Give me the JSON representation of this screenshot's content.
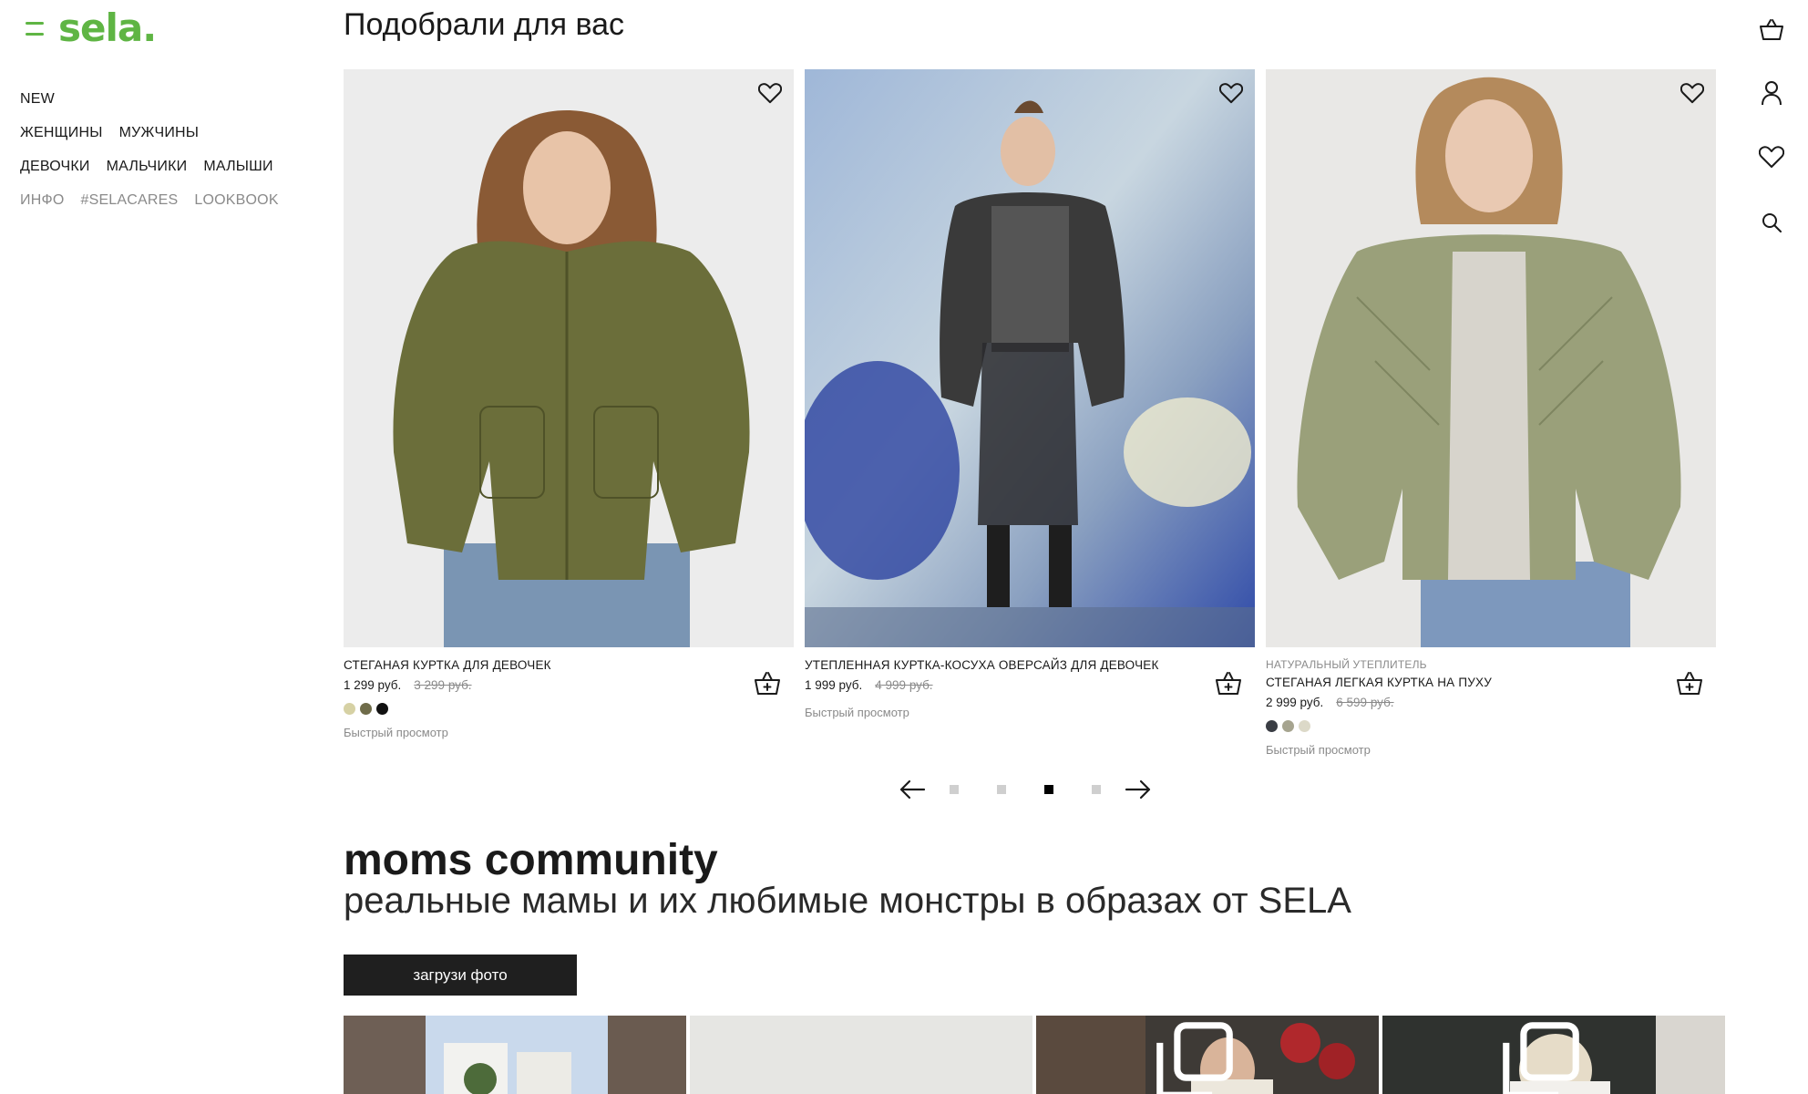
{
  "brand": {
    "name": "sela.",
    "color": "#5fb544"
  },
  "nav": {
    "rows": [
      [
        {
          "label": "NEW"
        }
      ],
      [
        {
          "label": "ЖЕНЩИНЫ"
        },
        {
          "label": "МУЖЧИНЫ"
        }
      ],
      [
        {
          "label": "ДЕВОЧКИ"
        },
        {
          "label": "МАЛЬЧИКИ"
        },
        {
          "label": "МАЛЫШИ"
        }
      ]
    ],
    "secondary": [
      {
        "label": "ИНФО"
      },
      {
        "label": "#SELACARES"
      },
      {
        "label": "LOOKBOOK"
      }
    ]
  },
  "rail": {
    "icons": [
      "basket-icon",
      "user-icon",
      "heart-icon",
      "search-icon"
    ]
  },
  "recommendations": {
    "title": "Подобрали для вас",
    "products": [
      {
        "subtitle": "",
        "name": "СТЕГАНАЯ КУРТКА ДЛЯ ДЕВОЧЕК",
        "price": "1 299 руб.",
        "old_price": "3 299 руб.",
        "colors": [
          "#d6d1a4",
          "#6f6c4a",
          "#111111"
        ],
        "quick_view": "Быстрый просмотр"
      },
      {
        "subtitle": "",
        "name": "УТЕПЛЕННАЯ КУРТКА-КОСУХА ОВЕРСАЙЗ ДЛЯ ДЕВОЧЕК",
        "price": "1 999 руб.",
        "old_price": "4 999 руб.",
        "colors": [],
        "quick_view": "Быстрый просмотр"
      },
      {
        "subtitle": "НАТУРАЛЬНЫЙ УТЕПЛИТЕЛЬ",
        "name": "СТЕГАНАЯ ЛЕГКАЯ КУРТКА НА ПУХУ",
        "price": "2 999 руб.",
        "old_price": "6 599 руб.",
        "colors": [
          "#3a3d44",
          "#a6a48f",
          "#dcd9c8"
        ],
        "quick_view": "Быстрый просмотр"
      }
    ],
    "pager": {
      "pages": 4,
      "active": 3
    }
  },
  "community": {
    "title": "moms community",
    "subtitle": "реальные мамы и их любимые монстры в образах от SELA",
    "upload_label": "загрузи фото"
  }
}
